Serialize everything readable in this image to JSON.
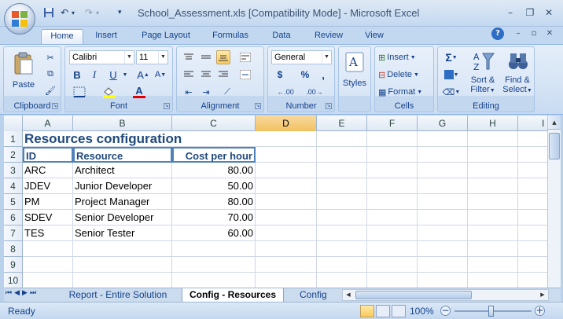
{
  "window": {
    "title": "School_Assessment.xls  [Compatibility Mode] - Microsoft Excel",
    "minimize": "–",
    "restore": "❐",
    "close": "✕"
  },
  "qat": {
    "undo": "↶",
    "redo": "↷"
  },
  "ribbon_tabs": [
    "Home",
    "Insert",
    "Page Layout",
    "Formulas",
    "Data",
    "Review",
    "View"
  ],
  "ribbon": {
    "clipboard": {
      "label": "Clipboard",
      "paste": "Paste"
    },
    "font": {
      "label": "Font",
      "name": "Calibri",
      "size": "11",
      "bold": "B",
      "italic": "I",
      "underline": "U"
    },
    "alignment": {
      "label": "Alignment"
    },
    "number": {
      "label": "Number",
      "format": "General",
      "currency": "$",
      "percent": "%",
      "comma": ",",
      "inc_decimal": ".00",
      "dec_decimal": ".00"
    },
    "styles": {
      "label": "Styles"
    },
    "cells": {
      "label": "Cells",
      "insert": "Insert",
      "delete": "Delete",
      "format": "Format"
    },
    "editing": {
      "label": "Editing",
      "sum": "Σ",
      "sort": "Sort &",
      "sort2": "Filter",
      "find": "Find &",
      "find2": "Select"
    }
  },
  "columns": [
    "A",
    "B",
    "C",
    "D",
    "E",
    "F",
    "G",
    "H",
    "I"
  ],
  "rows": [
    "1",
    "2",
    "3",
    "4",
    "5",
    "6",
    "7",
    "8",
    "9",
    "10"
  ],
  "sheet": {
    "title": "Resources configuration",
    "headers": [
      "ID",
      "Resource",
      "Cost per hour"
    ],
    "data": [
      [
        "ARC",
        "Architect",
        "80.00"
      ],
      [
        "JDEV",
        "Junior Developer",
        "50.00"
      ],
      [
        "PM",
        "Project Manager",
        "80.00"
      ],
      [
        "SDEV",
        "Senior Developer",
        "70.00"
      ],
      [
        "TES",
        "Senior Tester",
        "60.00"
      ]
    ]
  },
  "sheet_tabs": [
    "Report - Entire Solution",
    "Config - Resources",
    "Config"
  ],
  "status": {
    "ready": "Ready",
    "zoom": "100%",
    "zoom_out": "−",
    "zoom_in": "+"
  },
  "colors": {
    "accent": "#1f497d",
    "header_border": "#4f81bd",
    "selected_column": "#f1c15f"
  }
}
